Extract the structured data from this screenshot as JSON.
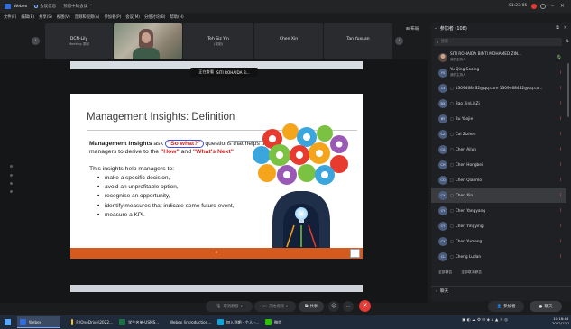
{
  "app": {
    "title": "Webex",
    "meeting_info": "会议信息",
    "recording_status": "预留中的会议"
  },
  "menu": [
    "文件(F)",
    "编辑(E)",
    "共享(S)",
    "视图(V)",
    "音频和视频(A)",
    "参加者(P)",
    "会议(M)",
    "分组讨论(B)",
    "帮助(H)"
  ],
  "timer": "01:23:05",
  "video_strip": {
    "tiles": [
      {
        "name": "DCN-Lily",
        "sub": "Meeting 录制"
      },
      {
        "name": "",
        "sub": ""
      },
      {
        "name": "Teh Siz Yin",
        "sub": "(录制)"
      },
      {
        "name": "Chen Xin",
        "sub": ""
      },
      {
        "name": "Tan Yuxuan",
        "sub": ""
      }
    ]
  },
  "share": {
    "viewing_label": "正在查看",
    "presenter": "SITI ROHAIDA B..."
  },
  "slide": {
    "title": "Management Insights: Definition",
    "para_bold": "Management Insights",
    "para_1": " ask ",
    "para_circled": "\"So what?\"",
    "para_2": " questions that helps the managers to derive to the ",
    "para_how": "\"How\"",
    "para_3": " and ",
    "para_next": "\"What's Next\"",
    "subheading": "This insights help managers to:",
    "bullets": [
      "make a specific decision,",
      "avoid an unprofitable option,",
      "recognise an opportunity,",
      "identify measures that indicate some future event,",
      "measure a KPI."
    ],
    "footer_page": "1"
  },
  "controls": {
    "mute": "取消静音",
    "video": "开始视频",
    "share": "共享",
    "more": "…"
  },
  "layout_label": "布局",
  "panel": {
    "title": "参加者 (108)",
    "search_placeholder": "搜索",
    "participants": [
      {
        "name": "SITI ROHAIDA BINTI MOHAMED ZIN...",
        "role": "我的主持人",
        "initials": "",
        "photo": true
      },
      {
        "name": "Yu Qing Sooing",
        "role": "我的主持人",
        "initials": "YS"
      },
      {
        "name": "13094684S2@qq.com 13094684S2@qq.co...",
        "role": "",
        "initials": "13"
      },
      {
        "name": "Bao XinLinZi",
        "role": "",
        "initials": "BX"
      },
      {
        "name": "Bu Yaojie",
        "role": "",
        "initials": "BY"
      },
      {
        "name": "Cai Zizhen",
        "role": "",
        "initials": "CZ"
      },
      {
        "name": "Chen Ailun",
        "role": "",
        "initials": "CA"
      },
      {
        "name": "Chen Hongbei",
        "role": "",
        "initials": "CH"
      },
      {
        "name": "Chen Qianmo",
        "role": "",
        "initials": "CQ"
      },
      {
        "name": "Chen Xin",
        "role": "",
        "initials": "CX"
      },
      {
        "name": "Chen Yangyang",
        "role": "",
        "initials": "CY"
      },
      {
        "name": "Chen Yingying",
        "role": "",
        "initials": "CY"
      },
      {
        "name": "Chen Yumeng",
        "role": "",
        "initials": "CY"
      },
      {
        "name": "Cheng Ludan",
        "role": "",
        "initials": "CL"
      }
    ],
    "context": [
      "全部静音",
      "全部取消静音"
    ],
    "chat": "聊天"
  },
  "buttons": {
    "join": "参加者",
    "chat": "聊天"
  },
  "taskbar": {
    "items": [
      "Webex",
      "F:\\OneDrive\\2022...",
      "学生名单-USMS...",
      "Webex (introduction...",
      "加入到期 - 个人 -...",
      "微信"
    ],
    "clock_time": "10:16:44",
    "clock_date": "2022/12/1"
  }
}
